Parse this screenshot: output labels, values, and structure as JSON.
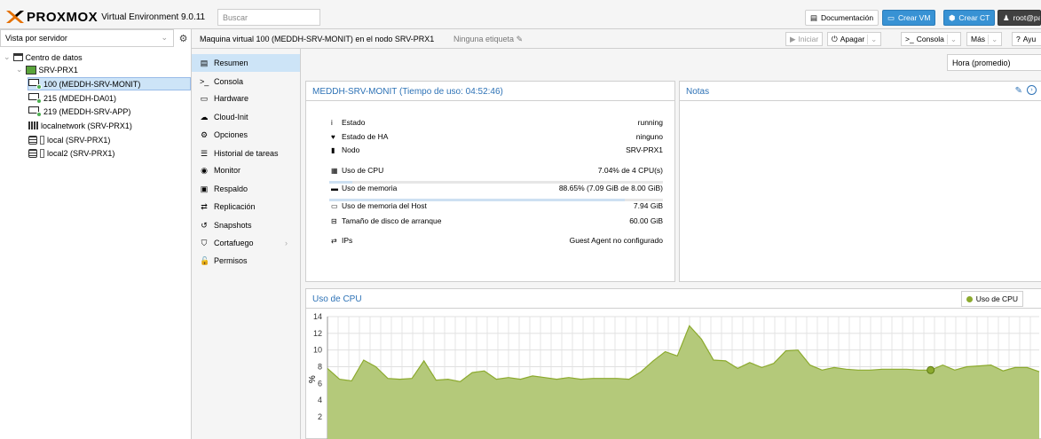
{
  "header": {
    "logo_text": "PROXMOX",
    "version_text": "Virtual Environment 9.0.11",
    "search_placeholder": "Buscar",
    "buttons": {
      "docs": "Documentación",
      "create_vm": "Crear VM",
      "create_ct": "Crear CT",
      "user": "root@pa"
    }
  },
  "tree": {
    "view_select": "Vista por servidor",
    "datacenter": "Centro de datos",
    "node": "SRV-PRX1",
    "items": [
      {
        "label": "100 (MEDDH-SRV-MONIT)",
        "icon": "vm-icon"
      },
      {
        "label": "215 (MDEDH-DA01)",
        "icon": "vm-icon"
      },
      {
        "label": "219 (MEDDH-SRV-APP)",
        "icon": "vm-icon"
      },
      {
        "label": "localnetwork (SRV-PRX1)",
        "icon": "network-icon"
      },
      {
        "label": "local (SRV-PRX1)",
        "icon": "storage-icon"
      },
      {
        "label": "local2 (SRV-PRX1)",
        "icon": "storage-icon"
      }
    ]
  },
  "titlebar": {
    "title": "Maquina virtual 100 (MEDDH-SRV-MONIT) en el nodo SRV-PRX1",
    "tags": "Ninguna etiqueta",
    "actions": {
      "start": "Iniciar",
      "shutdown": "Apagar",
      "console": "Consola",
      "more": "Más",
      "help": "Ayu"
    }
  },
  "menu": [
    {
      "label": "Resumen",
      "glyph": "▤"
    },
    {
      "label": "Consola",
      "glyph": ">_"
    },
    {
      "label": "Hardware",
      "glyph": "▭"
    },
    {
      "label": "Cloud-Init",
      "glyph": "☁"
    },
    {
      "label": "Opciones",
      "glyph": "⚙"
    },
    {
      "label": "Historial de tareas",
      "glyph": "☰"
    },
    {
      "label": "Monitor",
      "glyph": "◉"
    },
    {
      "label": "Respaldo",
      "glyph": "▣"
    },
    {
      "label": "Replicación",
      "glyph": "⇄"
    },
    {
      "label": "Snapshots",
      "glyph": "↺"
    },
    {
      "label": "Cortafuego",
      "glyph": "⛉"
    },
    {
      "label": "Permisos",
      "glyph": "🔓"
    }
  ],
  "time_select": "Hora (promedio)",
  "summary": {
    "title": "MEDDH-SRV-MONIT (Tiempo de uso: 04:52:46)",
    "rows": [
      {
        "label": "Estado",
        "value": "running",
        "glyph": "i"
      },
      {
        "label": "Estado de HA",
        "value": "ninguno",
        "glyph": "♥"
      },
      {
        "label": "Nodo",
        "value": "SRV-PRX1",
        "glyph": "▮"
      },
      {
        "label": "Uso de CPU",
        "value": "7.04% de 4 CPU(s)",
        "glyph": "▦"
      },
      {
        "label": "Uso de memoria",
        "value": "88.65% (7.09 GiB de 8.00 GiB)",
        "glyph": "▬"
      },
      {
        "label": "Uso de memoria del Host",
        "value": "7.94 GiB",
        "glyph": "▭"
      },
      {
        "label": "Tamaño de disco de arranque",
        "value": "60.00 GiB",
        "glyph": "⊟"
      },
      {
        "label": "IPs",
        "value": "Guest Agent no configurado",
        "glyph": "⇄"
      }
    ],
    "cpu_fraction": 0.0704,
    "mem_fraction": 0.8865
  },
  "notes": {
    "title": "Notas"
  },
  "cpu_chart": {
    "title": "Uso de CPU",
    "legend": "Uso de CPU",
    "ylabel": "%"
  },
  "chart_data": {
    "type": "area",
    "title": "Uso de CPU",
    "ylabel": "%",
    "ylim": [
      0,
      14
    ],
    "yticks": [
      2,
      4,
      6,
      8,
      10,
      12,
      14
    ],
    "grid": true,
    "series": [
      {
        "name": "Uso de CPU",
        "color": "#8caa2e",
        "values": [
          7.8,
          6.5,
          6.3,
          8.8,
          8.0,
          6.6,
          6.5,
          6.6,
          8.7,
          6.4,
          6.5,
          6.2,
          7.3,
          7.5,
          6.5,
          6.7,
          6.5,
          6.9,
          6.7,
          6.5,
          6.7,
          6.5,
          6.6,
          6.6,
          6.6,
          6.5,
          7.4,
          8.7,
          9.8,
          9.3,
          12.9,
          11.3,
          8.8,
          8.7,
          7.8,
          8.5,
          7.9,
          8.4,
          9.9,
          10.0,
          8.2,
          7.6,
          7.9,
          7.7,
          7.6,
          7.6,
          7.7,
          7.7,
          7.7,
          7.6,
          7.6,
          8.2,
          7.6,
          8.0,
          8.1,
          8.2,
          7.5,
          7.9,
          7.9,
          7.4
        ]
      }
    ],
    "highlight_index": 50
  }
}
